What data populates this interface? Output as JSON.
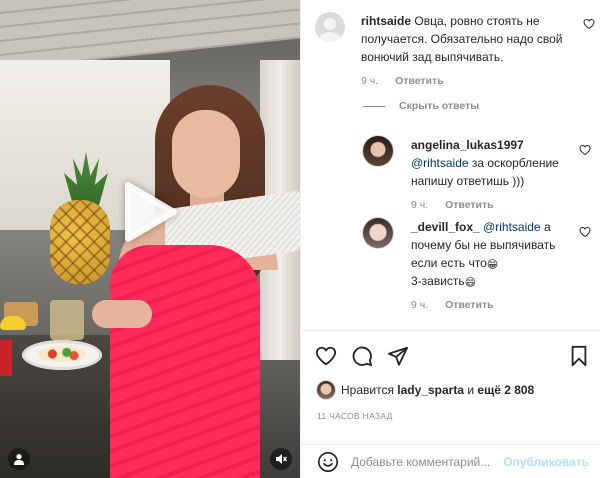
{
  "main_comment": {
    "username": "rihtsaide",
    "text": "Овца, ровно стоять не получается. Обязательно надо свой вонючий зад выпячивать.",
    "time": "9 ч.",
    "reply_label": "Ответить"
  },
  "hide_replies_label": "Скрыть ответы",
  "replies": [
    {
      "username": "angelina_lukas1997",
      "mention": "@rihtsaide",
      "text": "за оскорбление напишу ответишь )))",
      "time": "9 ч.",
      "reply_label": "Ответить"
    },
    {
      "username": "_devill_fox_",
      "mention": "@rihtsaide",
      "text_1": "а почему бы не выпячивать если есть что",
      "emoji_1": "😁",
      "text_2": "3-зависть",
      "emoji_2": "😄",
      "time": "9 ч.",
      "reply_label": "Ответить"
    }
  ],
  "likes": {
    "prefix": "Нравится",
    "user": "lady_sparta",
    "middle": "и",
    "rest": "ещё 2 808"
  },
  "time_ago": "11 ЧАСОВ НАЗАД",
  "composer": {
    "placeholder": "Добавьте комментарий...",
    "publish_label": "Опубликовать"
  },
  "icons": {
    "heart": "heart-icon",
    "comment": "comment-icon",
    "share": "share-icon",
    "bookmark": "bookmark-icon",
    "play": "play-icon",
    "user": "user-icon",
    "mute": "mute-icon",
    "emoji": "emoji-icon"
  },
  "colors": {
    "link_blue": "#00376b",
    "muted_gray": "#8e8e8e",
    "publish_disabled": "#b2dffc",
    "text": "#262626"
  }
}
